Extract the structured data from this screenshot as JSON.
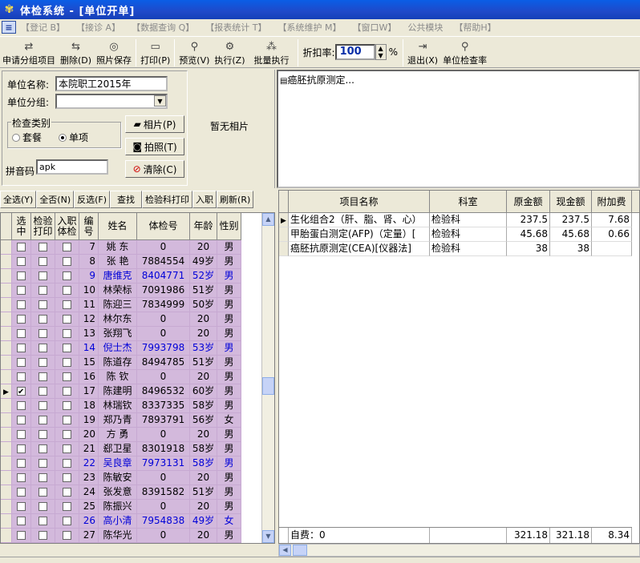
{
  "window": {
    "title": "体检系统 - [单位开单]"
  },
  "menu": [
    "【登记 B】",
    "【接诊 A】",
    "【数据查询 Q】",
    "【报表统计 T】",
    "【系统维护 M】",
    "【窗口W】",
    "公共模块",
    "【帮助H】"
  ],
  "toolbar": {
    "apply_group": "申请分组项目",
    "delete": "删除(D)",
    "photo_save": "照片保存",
    "print": "打印(P)",
    "preview": "预览(V)",
    "execute": "执行(Z)",
    "batch_execute": "批量执行",
    "discount_label": "折扣率:",
    "discount_value": "100",
    "percent": "%",
    "exit": "退出(X)",
    "unit_check_rate": "单位检查率"
  },
  "form": {
    "unit_name_label": "单位名称:",
    "unit_name": "本院职工2015年",
    "unit_group_label": "单位分组:",
    "unit_group": "",
    "exam_type_label": "检查类别",
    "type_package": "套餐",
    "type_single": "单项",
    "pinyin_label": "拼音码",
    "pinyin": "apk",
    "btn_photo": "相片(P)",
    "btn_capture": "拍照(T)",
    "btn_clear": "清除(C)",
    "no_photo": "暂无相片"
  },
  "result_text": "癌胚抗原测定...",
  "left_toolbar": [
    "全选(Y)",
    "全否(N)",
    "反选(F)",
    "查找",
    "检验科打印",
    "入职",
    "刷新(R)"
  ],
  "grid": {
    "headers": {
      "select": "选中",
      "lab_print": "检验打印",
      "onboard": "入职体检",
      "no": "编号",
      "name": "姓名",
      "exam_no": "体检号",
      "age": "年龄",
      "sex": "性别"
    },
    "rows": [
      {
        "no": "7",
        "name": "姚  东",
        "exam_no": "0",
        "age": "20",
        "sex": "男",
        "blue": false,
        "checked": false
      },
      {
        "no": "8",
        "name": "张  艳",
        "exam_no": "7884554",
        "age": "49岁",
        "sex": "男",
        "blue": false,
        "checked": false
      },
      {
        "no": "9",
        "name": "唐维克",
        "exam_no": "8404771",
        "age": "52岁",
        "sex": "男",
        "blue": true,
        "checked": false
      },
      {
        "no": "10",
        "name": "林荣标",
        "exam_no": "7091986",
        "age": "51岁",
        "sex": "男",
        "blue": false,
        "checked": false
      },
      {
        "no": "11",
        "name": "陈迎三",
        "exam_no": "7834999",
        "age": "50岁",
        "sex": "男",
        "blue": false,
        "checked": false
      },
      {
        "no": "12",
        "name": "林尔东",
        "exam_no": "0",
        "age": "20",
        "sex": "男",
        "blue": false,
        "checked": false
      },
      {
        "no": "13",
        "name": "张翔飞",
        "exam_no": "0",
        "age": "20",
        "sex": "男",
        "blue": false,
        "checked": false
      },
      {
        "no": "14",
        "name": "倪士杰",
        "exam_no": "7993798",
        "age": "53岁",
        "sex": "男",
        "blue": true,
        "checked": false
      },
      {
        "no": "15",
        "name": "陈道存",
        "exam_no": "8494785",
        "age": "51岁",
        "sex": "男",
        "blue": false,
        "checked": false
      },
      {
        "no": "16",
        "name": "陈  钦",
        "exam_no": "0",
        "age": "20",
        "sex": "男",
        "blue": false,
        "checked": false
      },
      {
        "no": "17",
        "name": "陈建明",
        "exam_no": "8496532",
        "age": "60岁",
        "sex": "男",
        "blue": false,
        "checked": true
      },
      {
        "no": "18",
        "name": "林瑞钦",
        "exam_no": "8337335",
        "age": "58岁",
        "sex": "男",
        "blue": false,
        "checked": false
      },
      {
        "no": "19",
        "name": "郑乃青",
        "exam_no": "7893791",
        "age": "56岁",
        "sex": "女",
        "blue": false,
        "checked": false
      },
      {
        "no": "20",
        "name": "方  勇",
        "exam_no": "0",
        "age": "20",
        "sex": "男",
        "blue": false,
        "checked": false
      },
      {
        "no": "21",
        "name": "郄卫星",
        "exam_no": "8301918",
        "age": "58岁",
        "sex": "男",
        "blue": false,
        "checked": false
      },
      {
        "no": "22",
        "name": "吴良章",
        "exam_no": "7973131",
        "age": "58岁",
        "sex": "男",
        "blue": true,
        "checked": false
      },
      {
        "no": "23",
        "name": "陈敏安",
        "exam_no": "0",
        "age": "20",
        "sex": "男",
        "blue": false,
        "checked": false
      },
      {
        "no": "24",
        "name": "张发意",
        "exam_no": "8391582",
        "age": "51岁",
        "sex": "男",
        "blue": false,
        "checked": false
      },
      {
        "no": "25",
        "name": "陈振兴",
        "exam_no": "0",
        "age": "20",
        "sex": "男",
        "blue": false,
        "checked": false
      },
      {
        "no": "26",
        "name": "高小清",
        "exam_no": "7954838",
        "age": "49岁",
        "sex": "女",
        "blue": true,
        "checked": false
      },
      {
        "no": "27",
        "name": "陈华光",
        "exam_no": "0",
        "age": "20",
        "sex": "男",
        "blue": false,
        "checked": false
      }
    ]
  },
  "items": {
    "headers": {
      "name": "项目名称",
      "dept": "科室",
      "orig": "原金额",
      "curr": "现金额",
      "extra": "附加费"
    },
    "rows": [
      {
        "name": "生化组合2（肝、脂、肾、心）",
        "dept": "检验科",
        "orig": "237.5",
        "curr": "237.5",
        "extra": "7.68"
      },
      {
        "name": "甲胎蛋白测定(AFP)（定量）[",
        "dept": "检验科",
        "orig": "45.68",
        "curr": "45.68",
        "extra": "0.66"
      },
      {
        "name": "癌胚抗原测定(CEA)[仪器法]",
        "dept": "检验科",
        "orig": "38",
        "curr": "38",
        "extra": ""
      }
    ],
    "footer": {
      "self_pay": "自费：0",
      "orig_total": "321.18",
      "curr_total": "321.18",
      "extra_total": "8.34"
    }
  }
}
